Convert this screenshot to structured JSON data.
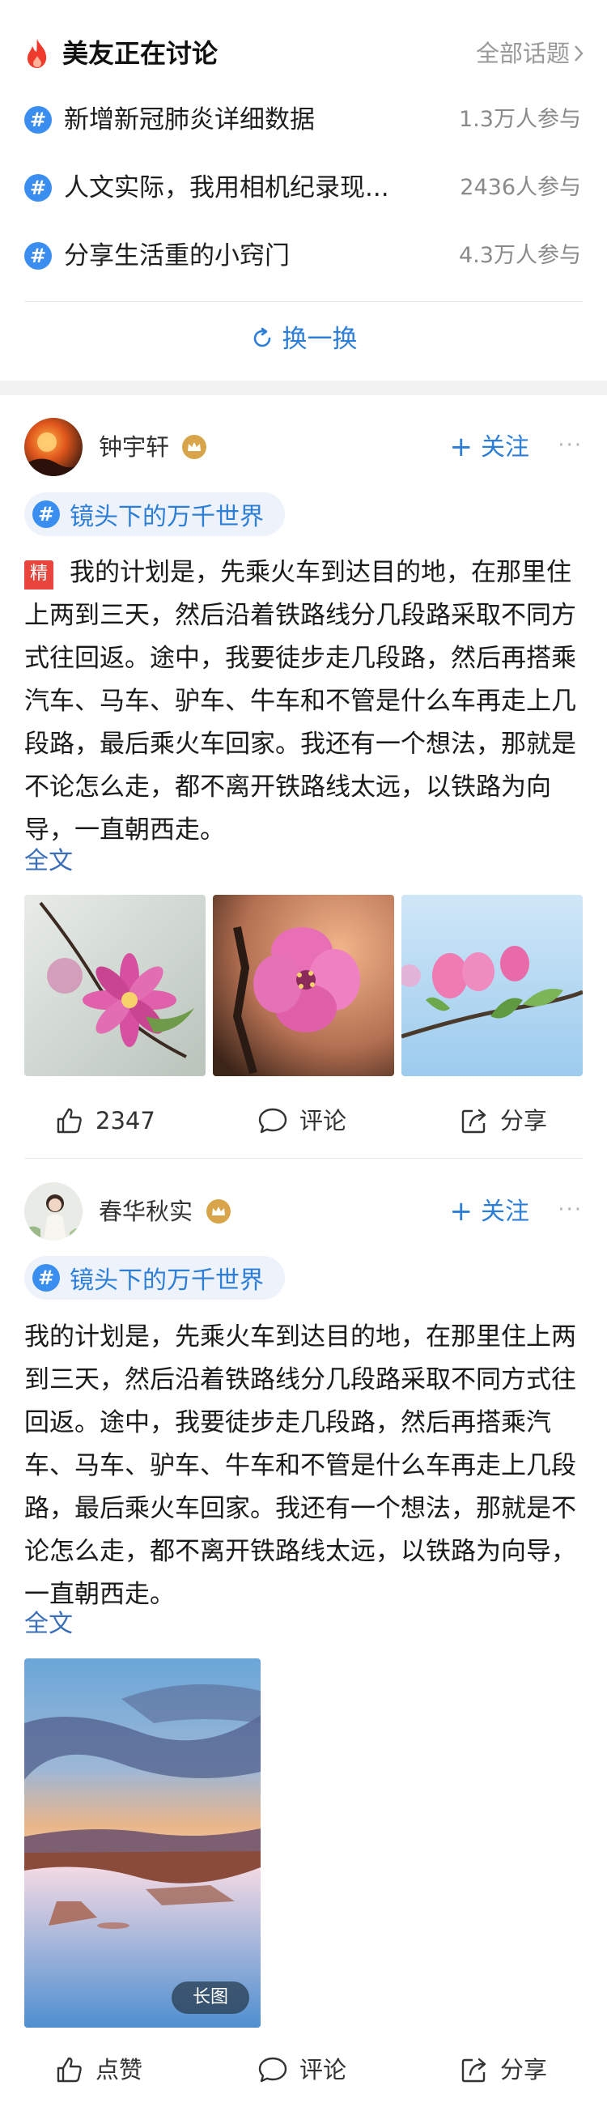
{
  "topics": {
    "title": "美友正在讨论",
    "all_label": "全部话题",
    "items": [
      {
        "label": "新增新冠肺炎详细数据",
        "count": "1.3万人参与"
      },
      {
        "label": "人文实际，我用相机纪录现...",
        "count": "2436人参与"
      },
      {
        "label": "分享生活重的小窍门",
        "count": "4.3万人参与"
      }
    ],
    "refresh_label": "换一换"
  },
  "posts": [
    {
      "username": "钟宇轩",
      "follow_label": "关注",
      "more": "···",
      "tag": "镜头下的万千世界",
      "featured_badge": "精",
      "text": "我的计划是，先乘火车到达目的地，在那里住上两到三天，然后沿着铁路线分几段路采取不同方式往回返。途中，我要徒步走几段路，然后再搭乘汽车、马车、驴车、牛车和不管是什么车再走上几段路，最后乘火车回家。我还有一个想法，那就是不论怎么走，都不离开铁路线太远，以铁路为向导，一直朝西走。",
      "fulltext_label": "全文",
      "likes": "2347",
      "comment_label": "评论",
      "share_label": "分享"
    },
    {
      "username": "春华秋实",
      "follow_label": "关注",
      "more": "···",
      "tag": "镜头下的万千世界",
      "text": "我的计划是，先乘火车到达目的地，在那里住上两到三天，然后沿着铁路线分几段路采取不同方式往回返。途中，我要徒步走几段路，然后再搭乘汽车、马车、驴车、牛车和不管是什么车再走上几段路，最后乘火车回家。我还有一个想法，那就是不论怎么走，都不离开铁路线太远，以铁路为向导，一直朝西走。",
      "fulltext_label": "全文",
      "long_image_badge": "长图",
      "likes": "点赞",
      "comment_label": "评论",
      "share_label": "分享"
    }
  ],
  "colors": {
    "accent": "#2c7ed6",
    "hash": "#3a8ef0",
    "featured": "#e8463c",
    "crown": "#d8a54a"
  }
}
